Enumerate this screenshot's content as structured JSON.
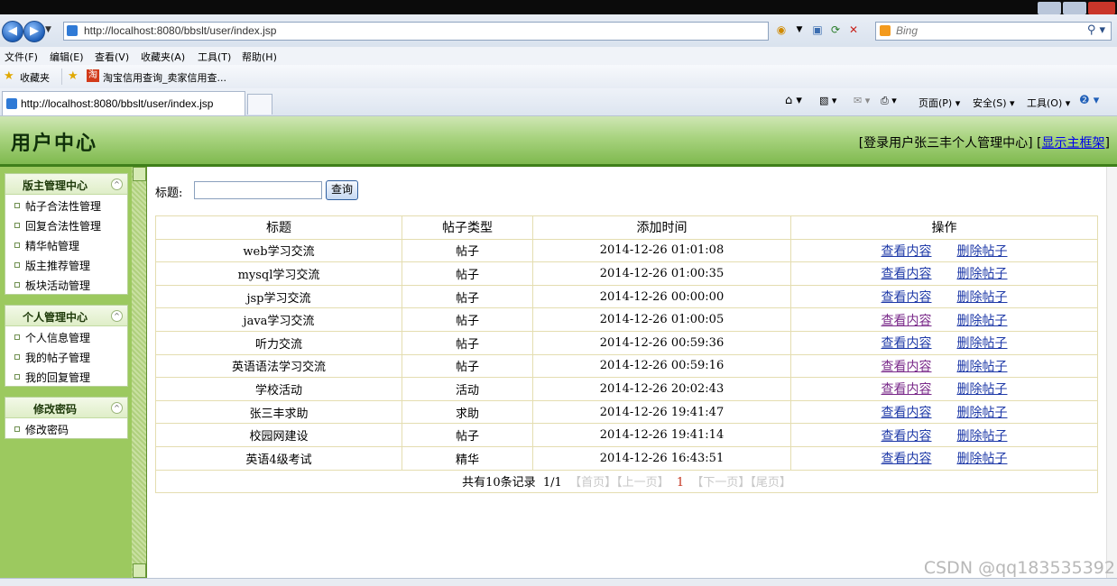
{
  "browser": {
    "address_url": "http://localhost:8080/bbslt/user/index.jsp",
    "search_engine": "Bing",
    "menu": [
      "文件(F)",
      "编辑(E)",
      "查看(V)",
      "收藏夹(A)",
      "工具(T)",
      "帮助(H)"
    ],
    "favorites_label": "收藏夹",
    "favorite_link": "淘宝信用查询_卖家信用查...",
    "tab_title": "http://localhost:8080/bbslt/user/index.jsp",
    "tab_tools": [
      "页面(P) ▾",
      "安全(S) ▾",
      "工具(O) ▾"
    ]
  },
  "header": {
    "title": "用户中心",
    "login_info": "[登录用户张三丰个人管理中心] [",
    "show_frame_link": "显示主框架",
    "close_bracket": "]"
  },
  "sidebar": {
    "panels": [
      {
        "title": "版主管理中心",
        "items": [
          "帖子合法性管理",
          "回复合法性管理",
          "精华帖管理",
          "版主推荐管理",
          "板块活动管理"
        ]
      },
      {
        "title": "个人管理中心",
        "items": [
          "个人信息管理",
          "我的帖子管理",
          "我的回复管理"
        ]
      },
      {
        "title": "修改密码",
        "items": [
          "修改密码"
        ]
      }
    ]
  },
  "search": {
    "label": "标题:",
    "value": "",
    "button_label": "查询"
  },
  "table": {
    "headers": [
      "标题",
      "帖子类型",
      "添加时间",
      "操作"
    ],
    "rows": [
      {
        "title": "web学习交流",
        "type": "帖子",
        "time": "2014-12-26 01:01:08",
        "view": "查看内容",
        "delete": "删除帖子"
      },
      {
        "title": "mysql学习交流",
        "type": "帖子",
        "time": "2014-12-26 01:00:35",
        "view": "查看内容",
        "delete": "删除帖子"
      },
      {
        "title": "jsp学习交流",
        "type": "帖子",
        "time": "2014-12-26 00:00:00",
        "view": "查看内容",
        "delete": "删除帖子"
      },
      {
        "title": "java学习交流",
        "type": "帖子",
        "time": "2014-12-26 01:00:05",
        "view": "查看内容",
        "delete": "删除帖子"
      },
      {
        "title": "听力交流",
        "type": "帖子",
        "time": "2014-12-26 00:59:36",
        "view": "查看内容",
        "delete": "删除帖子"
      },
      {
        "title": "英语语法学习交流",
        "type": "帖子",
        "time": "2014-12-26 00:59:16",
        "view": "查看内容",
        "delete": "删除帖子"
      },
      {
        "title": "学校活动",
        "type": "活动",
        "time": "2014-12-26 20:02:43",
        "view": "查看内容",
        "delete": "删除帖子"
      },
      {
        "title": "张三丰求助",
        "type": "求助",
        "time": "2014-12-26 19:41:47",
        "view": "查看内容",
        "delete": "删除帖子"
      },
      {
        "title": "校园网建设",
        "type": "帖子",
        "time": "2014-12-26 19:41:14",
        "view": "查看内容",
        "delete": "删除帖子"
      },
      {
        "title": "英语4级考试",
        "type": "精华",
        "time": "2014-12-26 16:43:51",
        "view": "查看内容",
        "delete": "删除帖子"
      }
    ],
    "visited_view_rows": [
      3,
      5,
      6
    ]
  },
  "pager": {
    "total_text": "共有10条记录",
    "page_info": "1/1",
    "first": "【首页】",
    "prev": "【上一页】",
    "current": "1",
    "next": "【下一页】",
    "last": "【尾页】"
  },
  "watermark": "CSDN @qq183535392",
  "colors": {
    "header_green": "#7fb94f",
    "sidebar_green": "#9cc95f",
    "link_blue": "#1f3aa8",
    "visited_link": "#7a2a8a",
    "pager_current": "#c4321c"
  }
}
